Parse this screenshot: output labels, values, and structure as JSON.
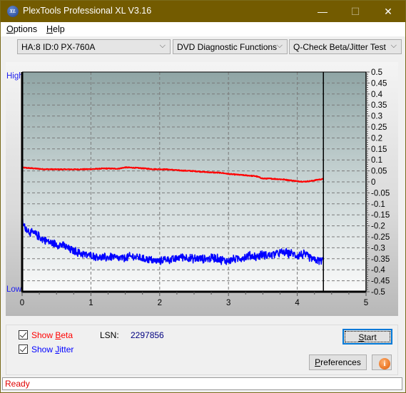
{
  "window": {
    "title": "PlexTools Professional XL V3.16",
    "icon_label": "XL",
    "controls": {
      "minimize": "—",
      "maximize": "☐",
      "close": "✕"
    }
  },
  "menu": [
    {
      "label": "Options",
      "accel": "O"
    },
    {
      "label": "Help",
      "accel": "H"
    }
  ],
  "toolbar": {
    "drive_select": "HA:8 ID:0  PX-760A",
    "function_select": "DVD Diagnostic Functions",
    "test_select": "Q-Check Beta/Jitter Test",
    "chevron": "⌵"
  },
  "chart_labels": {
    "high": "High",
    "low": "Low"
  },
  "chart_data": {
    "type": "line",
    "title": "",
    "xlabel": "",
    "ylabel": "",
    "xlim": [
      0,
      5
    ],
    "ylim": [
      -0.5,
      0.5
    ],
    "x_ticks": [
      "0",
      "1",
      "2",
      "3",
      "4",
      "5"
    ],
    "y_ticks": [
      "0.5",
      "0.45",
      "0.4",
      "0.35",
      "0.3",
      "0.25",
      "0.2",
      "0.15",
      "0.1",
      "0.05",
      "0",
      "-0.05",
      "-0.1",
      "-0.15",
      "-0.2",
      "-0.25",
      "-0.3",
      "-0.35",
      "-0.4",
      "-0.45",
      "-0.5"
    ],
    "grid": true,
    "end_marker_x": 4.38,
    "series": [
      {
        "name": "Beta",
        "color": "#ff0000",
        "x": [
          0,
          0.1,
          0.3,
          0.5,
          0.8,
          1.0,
          1.2,
          1.4,
          1.5,
          1.7,
          1.9,
          2.1,
          2.3,
          2.5,
          2.7,
          2.9,
          3.0,
          3.2,
          3.4,
          3.5,
          3.6,
          3.8,
          4.0,
          4.1,
          4.2,
          4.3,
          4.38
        ],
        "y": [
          0.065,
          0.063,
          0.058,
          0.057,
          0.057,
          0.058,
          0.061,
          0.06,
          0.066,
          0.063,
          0.058,
          0.057,
          0.052,
          0.049,
          0.044,
          0.041,
          0.036,
          0.031,
          0.026,
          0.015,
          0.015,
          0.011,
          0.003,
          0.001,
          0.004,
          0.01,
          0.013
        ]
      },
      {
        "name": "Jitter",
        "color": "#0000ff",
        "x": [
          0,
          0.02,
          0.1,
          0.2,
          0.3,
          0.4,
          0.5,
          0.6,
          0.7,
          0.8,
          0.9,
          1.0,
          1.1,
          1.2,
          1.3,
          1.4,
          1.5,
          1.6,
          1.7,
          1.8,
          1.9,
          2.0,
          2.1,
          2.2,
          2.3,
          2.4,
          2.5,
          2.6,
          2.7,
          2.8,
          2.9,
          3.0,
          3.1,
          3.2,
          3.3,
          3.4,
          3.5,
          3.6,
          3.7,
          3.8,
          3.9,
          4.0,
          4.1,
          4.2,
          4.3,
          4.38
        ],
        "y": [
          -0.15,
          -0.2,
          -0.225,
          -0.24,
          -0.26,
          -0.275,
          -0.285,
          -0.29,
          -0.31,
          -0.32,
          -0.33,
          -0.335,
          -0.34,
          -0.345,
          -0.34,
          -0.35,
          -0.345,
          -0.34,
          -0.345,
          -0.35,
          -0.36,
          -0.36,
          -0.35,
          -0.355,
          -0.34,
          -0.345,
          -0.35,
          -0.35,
          -0.35,
          -0.345,
          -0.355,
          -0.36,
          -0.35,
          -0.345,
          -0.335,
          -0.34,
          -0.33,
          -0.335,
          -0.325,
          -0.32,
          -0.325,
          -0.335,
          -0.33,
          -0.35,
          -0.36,
          -0.355
        ]
      }
    ]
  },
  "controls": {
    "show_beta": {
      "label": "Show Beta",
      "checked": true,
      "color": "#ff0000"
    },
    "show_jitter": {
      "label": "Show Jitter",
      "checked": true,
      "color": "#0000ff"
    },
    "lsn_label": "LSN:",
    "lsn_value": "2297856",
    "start_button": "Start",
    "preferences_button": "Preferences",
    "info_button": "i"
  },
  "status": {
    "text": "Ready"
  }
}
